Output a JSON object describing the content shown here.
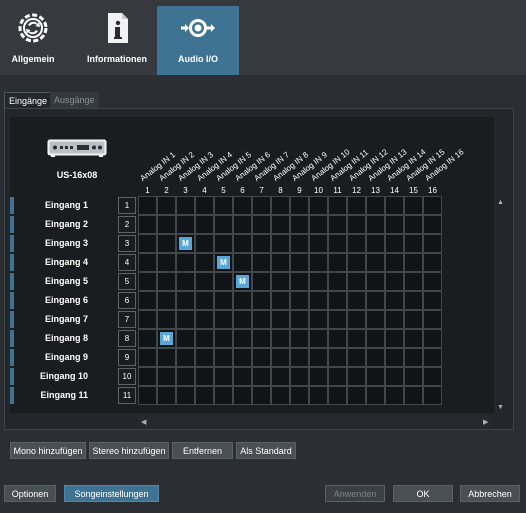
{
  "toolbar": {
    "items": [
      {
        "label": "Allgemein",
        "icon": "sync-gear-icon"
      },
      {
        "label": "Informationen",
        "icon": "info-document-icon"
      },
      {
        "label": "Audio I/O",
        "icon": "audio-io-icon"
      }
    ],
    "active": "Audio I/O"
  },
  "tabs": [
    {
      "label": "Eingänge",
      "active": true
    },
    {
      "label": "Ausgänge",
      "active": false
    }
  ],
  "device": {
    "name": "US-16x08",
    "icon": "audio-interface-icon"
  },
  "columns": {
    "labels": [
      "Analog IN 1",
      "Analog IN 2",
      "Analog IN 3",
      "Analog IN 4",
      "Analog IN 5",
      "Analog IN 6",
      "Analog IN 7",
      "Analog IN 8",
      "Analog IN 9",
      "Analog IN 10",
      "Analog IN 11",
      "Analog IN 12",
      "Analog IN 13",
      "Analog IN 14",
      "Analog IN 15",
      "Analog IN 16"
    ],
    "numbers": [
      "1",
      "2",
      "3",
      "4",
      "5",
      "6",
      "7",
      "8",
      "9",
      "10",
      "11",
      "12",
      "13",
      "14",
      "15",
      "16"
    ]
  },
  "rows": [
    {
      "label": "Eingang 1",
      "num": "1"
    },
    {
      "label": "Eingang 2",
      "num": "2"
    },
    {
      "label": "Eingang 3",
      "num": "3"
    },
    {
      "label": "Eingang 4",
      "num": "4"
    },
    {
      "label": "Eingang 5",
      "num": "5"
    },
    {
      "label": "Eingang 6",
      "num": "6"
    },
    {
      "label": "Eingang 7",
      "num": "7"
    },
    {
      "label": "Eingang 8",
      "num": "8"
    },
    {
      "label": "Eingang 9",
      "num": "9"
    },
    {
      "label": "Eingang 10",
      "num": "10"
    },
    {
      "label": "Eingang 11",
      "num": "11"
    }
  ],
  "assignments": [
    {
      "row": 3,
      "col": 3,
      "mark": "M"
    },
    {
      "row": 4,
      "col": 5,
      "mark": "M"
    },
    {
      "row": 5,
      "col": 6,
      "mark": "M"
    },
    {
      "row": 8,
      "col": 2,
      "mark": "M"
    }
  ],
  "matrix_buttons": {
    "mono": "Mono hinzufügen",
    "stereo": "Stereo hinzufügen",
    "remove": "Entfernen",
    "default": "Als Standard"
  },
  "footer": {
    "options": "Optionen",
    "song": "Songeinstellungen",
    "apply": "Anwenden",
    "ok": "OK",
    "cancel": "Abbrechen"
  },
  "colors": {
    "accent": "#3e7394",
    "mark": "#5aa6d6",
    "background": "#2b2f33"
  }
}
